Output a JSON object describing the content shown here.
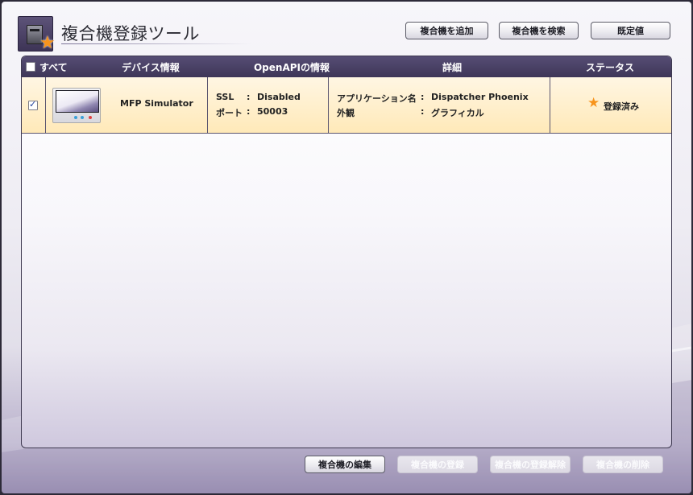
{
  "header": {
    "title": "複合機登録ツール",
    "add_button": "複合機を追加",
    "search_button": "複合機を検索",
    "defaults_button": "既定値"
  },
  "table": {
    "headers": {
      "select_all": "すべて",
      "device_info": "デバイス情報",
      "openapi_info": "OpenAPIの情報",
      "details": "詳細",
      "status": "ステータス"
    },
    "rows": [
      {
        "checked": true,
        "device_name": "MFP Simulator",
        "ssl_label": "SSL",
        "ssl_sep": ":",
        "ssl_value": "Disabled",
        "port_label": "ポート",
        "port_sep": ":",
        "port_value": "50003",
        "app_label": "アプリケーション名",
        "app_sep": ":",
        "app_value": "Dispatcher Phoenix",
        "look_label": "外観",
        "look_sep": ":",
        "look_value": "グラフィカル",
        "status": "登録済み"
      }
    ]
  },
  "footer": {
    "edit_button": "複合機の編集",
    "register_button": "複合機の登録",
    "unregister_button": "複合機の登録解除",
    "delete_button": "複合機の削除"
  },
  "colors": {
    "accent_star": "#f7941d",
    "header_bar": "#4a4266",
    "row_highlight": "#ffefc6"
  },
  "icons": {
    "app": "mfp-star-icon",
    "status": "star-icon",
    "checkbox": "checkbox-icon"
  }
}
